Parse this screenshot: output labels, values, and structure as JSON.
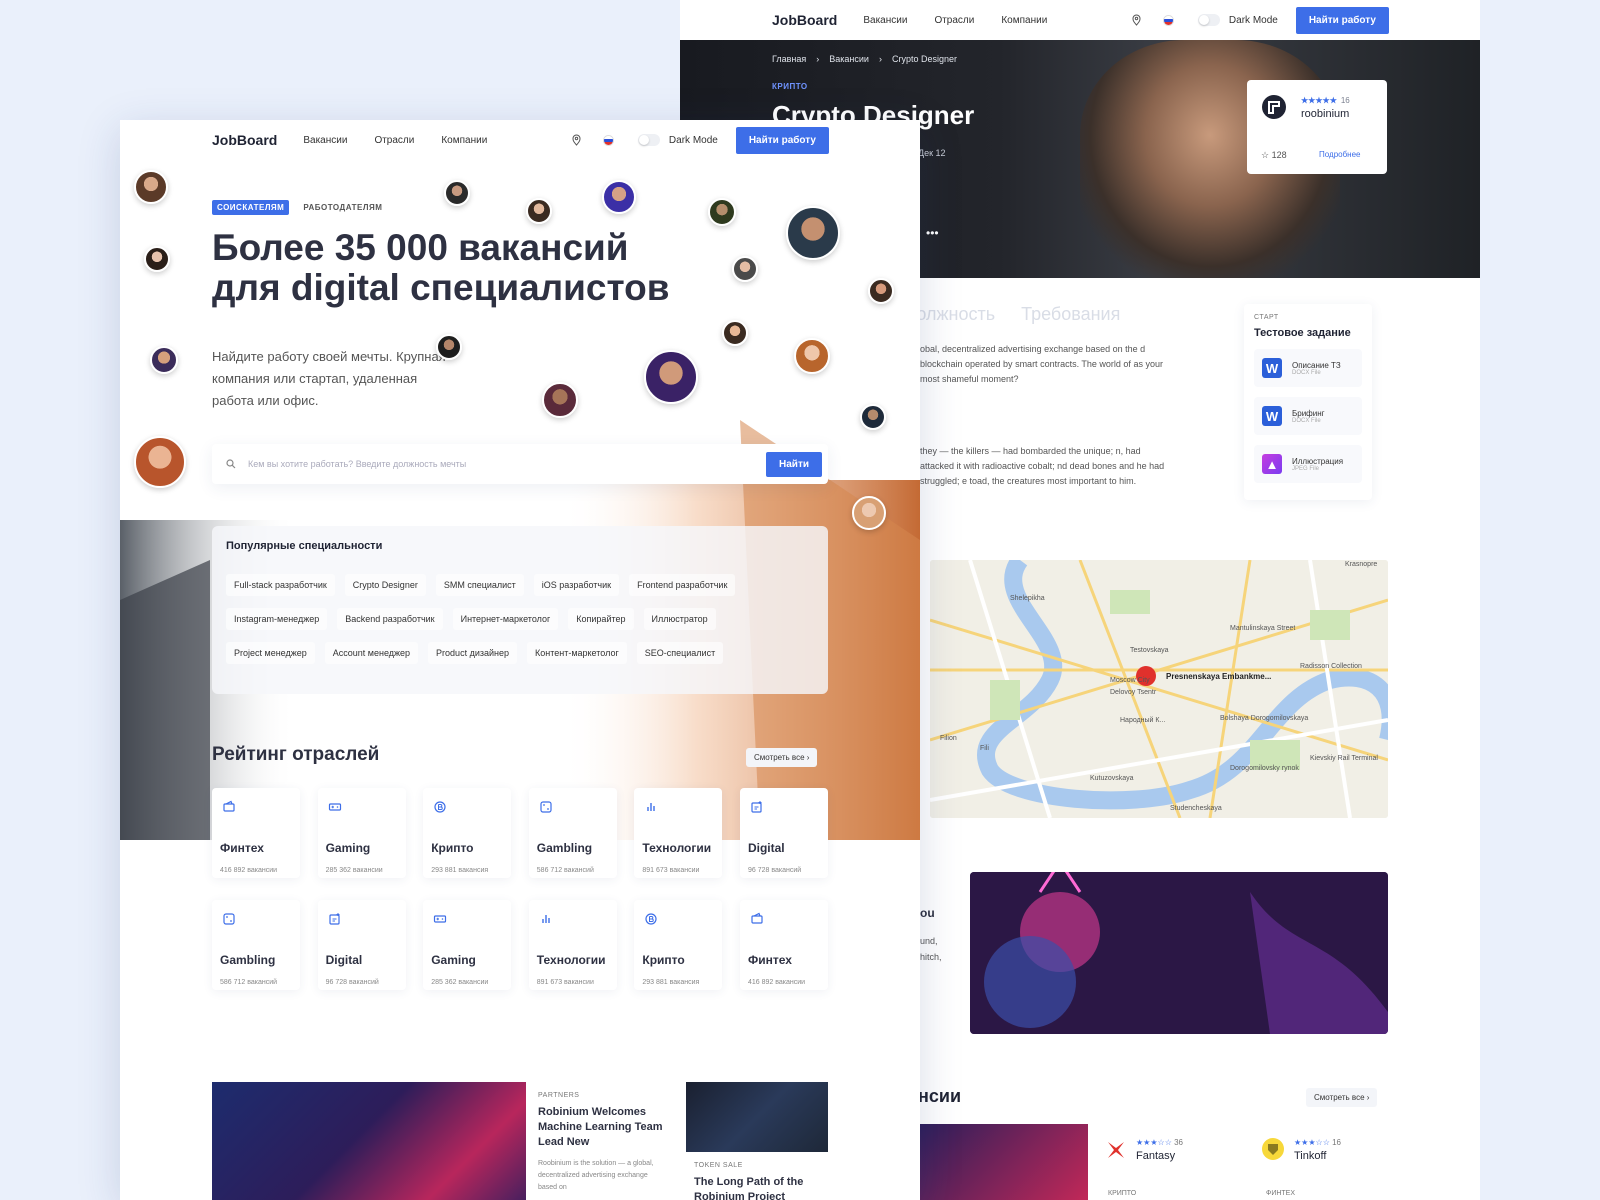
{
  "nav": {
    "brand": "JobBoard",
    "links": [
      "Вакансии",
      "Отрасли",
      "Компании"
    ],
    "dark_mode": "Dark Mode",
    "cta": "Найти работу",
    "icons": [
      "location-pin-icon",
      "flag-ru-icon"
    ]
  },
  "back": {
    "breadcrumbs": [
      "Главная",
      "Вакансии",
      "Crypto Designer"
    ],
    "tag": "КРИПТО",
    "title": "Crypto Designer",
    "date": "Дек 12",
    "company": {
      "name": "roobinium",
      "reviews": "16",
      "stars": "★★★★★",
      "favorites": "128",
      "link": "Подробнее"
    },
    "tabs": [
      "Должность",
      "Требования"
    ],
    "paragraph1": "obal, decentralized advertising exchange based on the d blockchain operated by smart contracts. The world of as your most shameful moment?",
    "paragraph2": "they — the killers — had bombarded the unique; n, had attacked it with radioactive cobalt; nd dead bones and he had struggled; e toad, the creatures most important to him.",
    "task": {
      "label": "СТАРТ",
      "title": "Тестовое задание",
      "files": [
        {
          "name": "Описание ТЗ",
          "type": "DOCX File",
          "icon": "word-icon"
        },
        {
          "name": "Брифинг",
          "type": "DOCX File",
          "icon": "word-icon"
        },
        {
          "name": "Иллюстрация",
          "type": "JPEG File",
          "icon": "image-icon"
        }
      ]
    },
    "map": {
      "pin_label": "Presnenskaya Embankme...",
      "labels": [
        "Shelepikha",
        "Testovskaya",
        "Mantulinskaya Street",
        "Krasnopre",
        "Radisson Collection",
        "Delovoy Tsentr",
        "Moscow City",
        "Народный К...",
        "Fili",
        "Kutuzovskaya",
        "Studencheskaya",
        "Kievskiy Rail Terminal",
        "Dorogomilovsky rynok",
        "Bolshaya Dorogomilovskaya",
        "Filion"
      ]
    },
    "banner_text": [
      "ou",
      "und,",
      "hitch,"
    ],
    "vacancies_heading": "нсии",
    "see_all": "Смотреть все",
    "jobs": [
      {
        "company": "Fantasy",
        "stars": "★★★☆☆",
        "reviews": "36",
        "tag": "КРИПТО"
      },
      {
        "company": "Tinkoff",
        "stars": "★★★☆☆",
        "reviews": "16",
        "tag": "ФИНТЕХ"
      }
    ]
  },
  "front": {
    "tabs": {
      "active": "СОИСКАТЕЛЯМ",
      "inactive": "РАБОТОДАТЕЛЯМ"
    },
    "headline_line1": "Более 35 000 вакансий",
    "headline_line2": "для digital специалистов",
    "sub": "Найдите работу своей мечты. Крупная компания или стартап, удаленная работа или офис.",
    "search": {
      "placeholder": "Кем вы хотите работать? Введите должность мечты",
      "value": "",
      "button": "Найти"
    },
    "popular": {
      "title": "Популярные специальности",
      "chips": [
        "Full-stack разработчик",
        "Crypto Designer",
        "SMM специалист",
        "iOS разработчик",
        "Frontend разработчик",
        "Instagram-менеджер",
        "Backend разработчик",
        "Интернет-маркетолог",
        "Копирайтер",
        "Иллюстратор",
        "Project менеджер",
        "Account менеджер",
        "Product дизайнер",
        "Контент-маркетолог",
        "SEO-специалист"
      ]
    },
    "industries": {
      "title": "Рейтинг отраслей",
      "see_all": "Смотреть все",
      "cards": [
        {
          "name": "Финтех",
          "count": "416 892 вакансии",
          "icon": "wallet-icon"
        },
        {
          "name": "Gaming",
          "count": "285 362 вакансии",
          "icon": "gamepad-icon"
        },
        {
          "name": "Крипто",
          "count": "293 881 вакансия",
          "icon": "bitcoin-icon"
        },
        {
          "name": "Gambling",
          "count": "586 712 вакансий",
          "icon": "dice-icon"
        },
        {
          "name": "Технологии",
          "count": "891 673 вакансии",
          "icon": "bar-chart-icon"
        },
        {
          "name": "Digital",
          "count": "96 728 вакансий",
          "icon": "digital-icon"
        },
        {
          "name": "Gambling",
          "count": "586 712 вакансий",
          "icon": "dice-icon"
        },
        {
          "name": "Digital",
          "count": "96 728 вакансий",
          "icon": "digital-icon"
        },
        {
          "name": "Gaming",
          "count": "285 362 вакансии",
          "icon": "gamepad-icon"
        },
        {
          "name": "Технологии",
          "count": "891 673 вакансии",
          "icon": "bar-chart-icon"
        },
        {
          "name": "Крипто",
          "count": "293 881 вакансия",
          "icon": "bitcoin-icon"
        },
        {
          "name": "Финтех",
          "count": "416 892 вакансии",
          "icon": "wallet-icon"
        }
      ]
    },
    "news": [
      {
        "label": "PARTNERS",
        "title": "Robinium Welcomes Machine Learning Team Lead New",
        "body": "Roobinium is the solution — a global, decentralized advertising exchange based on"
      },
      {
        "label": "TOKEN SALE",
        "title": "The Long Path of the Robinium Project"
      }
    ]
  },
  "colors": {
    "accent": "#3d6ee8",
    "page_bg": "#eaf0fb",
    "heading": "#2e3142"
  }
}
